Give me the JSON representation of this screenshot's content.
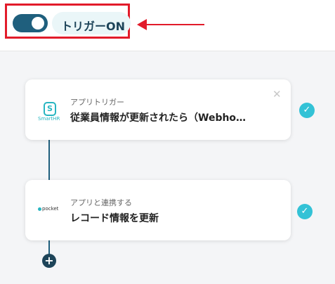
{
  "header": {
    "toggle_state": "on",
    "trigger_label": "トリガーON",
    "highlight_color": "#e21b2a",
    "accent_color": "#1f5f7d"
  },
  "flow": {
    "steps": [
      {
        "app_icon": "smarthr-logo",
        "app_icon_text": "SmartHR",
        "app_icon_glyph": "S",
        "subtitle": "アプリトリガー",
        "title": "従業員情報が更新されたら（Webho…",
        "status_icon": "check-icon",
        "close_icon": "close-icon"
      },
      {
        "app_icon": "pocket-logo",
        "app_icon_text": "pocket",
        "subtitle": "アプリと連携する",
        "title": "レコード情報を更新",
        "status_icon": "check-icon"
      }
    ],
    "add_icon": "plus-icon"
  },
  "colors": {
    "check": "#33c2d6",
    "canvas_bg": "#f4f5f7"
  }
}
